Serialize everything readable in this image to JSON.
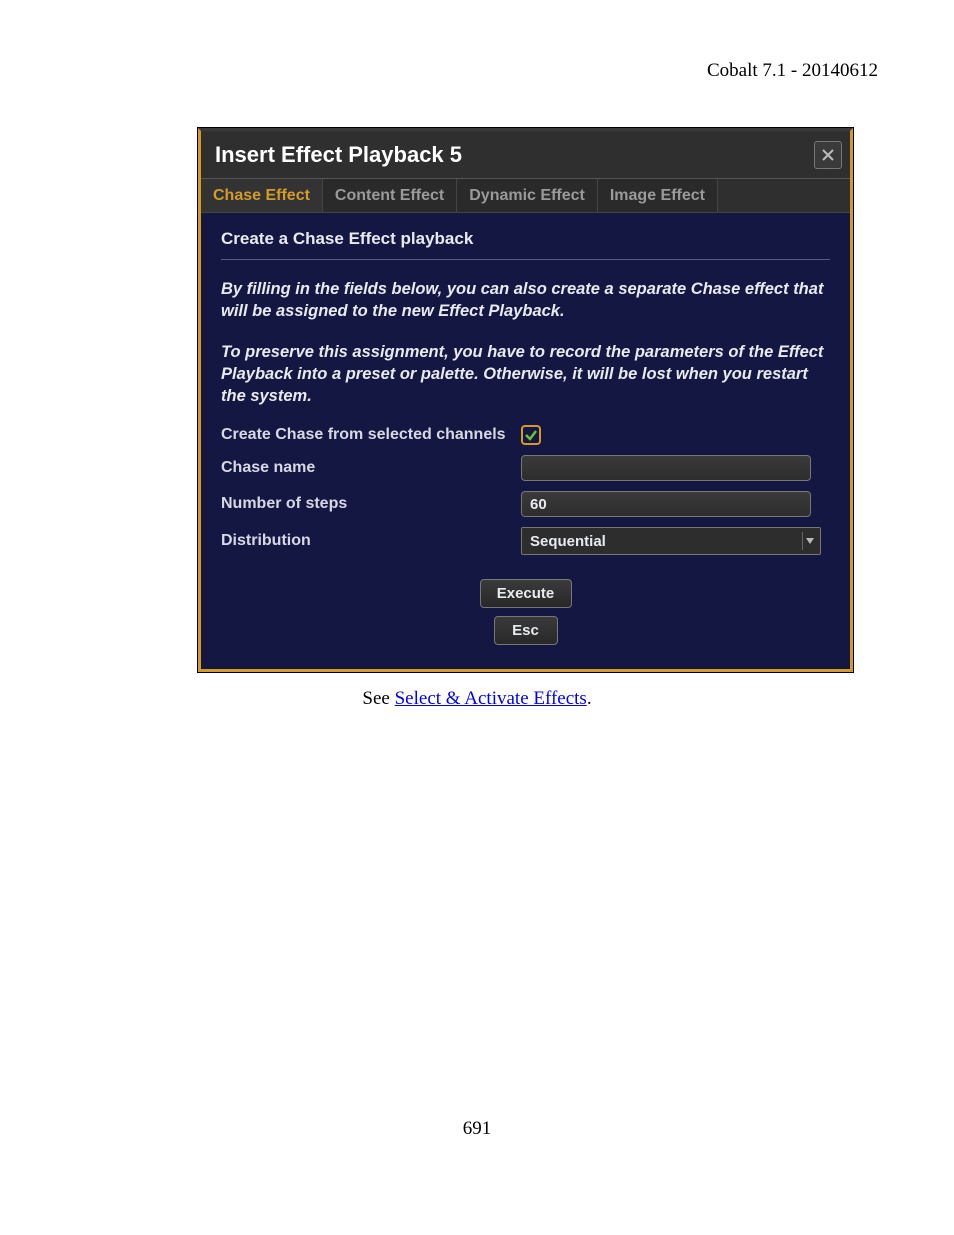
{
  "doc_header": "Cobalt 7.1 - 20140612",
  "dialog": {
    "title": "Insert Effect Playback 5",
    "tabs": [
      "Chase Effect",
      "Content Effect",
      "Dynamic Effect",
      "Image Effect"
    ],
    "active_tab_index": 0,
    "section_heading": "Create a Chase Effect playback",
    "paragraph1": "By filling in the fields below, you can also create a separate Chase effect that will be assigned to the new Effect Playback.",
    "paragraph2": "To preserve this assignment, you have to record the parameters of the Effect Playback into a preset or palette. Otherwise, it will be lost when you restart the system.",
    "rows": {
      "create_from_channels_label": "Create Chase from selected channels",
      "create_from_channels_checked": true,
      "chase_name_label": "Chase name",
      "chase_name_value": "",
      "steps_label": "Number of steps",
      "steps_value": "60",
      "distribution_label": "Distribution",
      "distribution_value": "Sequential"
    },
    "buttons": {
      "execute": "Execute",
      "esc": "Esc"
    }
  },
  "caption_prefix": "See ",
  "caption_link": "Select & Activate Effects",
  "caption_suffix": ".",
  "page_number": "691"
}
